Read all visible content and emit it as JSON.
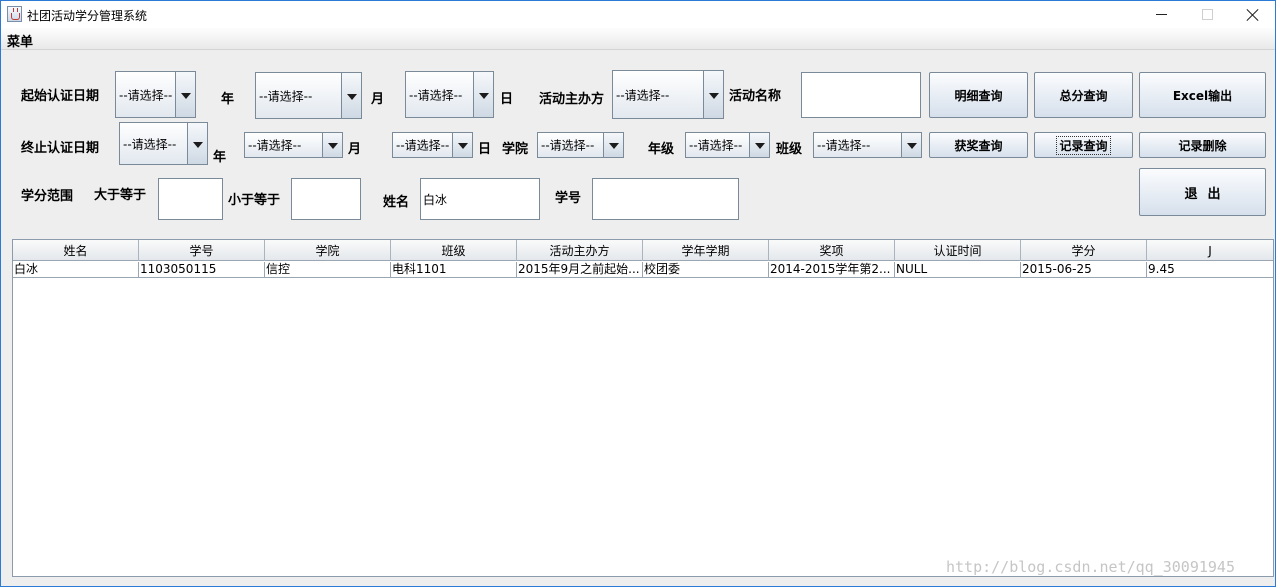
{
  "window": {
    "title": "社团活动学分管理系统"
  },
  "menubar": {
    "menu_label": "菜单"
  },
  "form": {
    "start_date_label": "起始认证日期",
    "end_date_label": "终止认证日期",
    "year_unit": "年",
    "month_unit": "月",
    "day_unit": "日",
    "organizer_label": "活动主办方",
    "activity_name_label": "活动名称",
    "college_label": "学院",
    "grade_label": "年级",
    "class_label": "班级",
    "credit_range_label": "学分范围",
    "gte_label": "大于等于",
    "lte_label": "小于等于",
    "name_label": "姓名",
    "student_id_label": "学号",
    "placeholder_option": "--请选择--",
    "activity_name_value": "",
    "credit_min_value": "",
    "credit_max_value": "",
    "name_value": "白冰",
    "student_id_value": ""
  },
  "buttons": {
    "detail_query": "明细查询",
    "total_query": "总分查询",
    "excel_export": "Excel输出",
    "award_query": "获奖查询",
    "record_query": "记录查询",
    "record_delete": "记录删除",
    "exit": "退出"
  },
  "table": {
    "columns": [
      "姓名",
      "学号",
      "学院",
      "班级",
      "活动主办方",
      "学年学期",
      "奖项",
      "认证时间",
      "学分",
      "J"
    ],
    "rows": [
      [
        "白冰",
        "1103050115",
        "信控",
        "电科1101",
        "2015年9月之前起始...",
        "校团委",
        "2014-2015学年第2...",
        "NULL",
        "2015-06-25",
        "9.45"
      ]
    ]
  },
  "watermark": "http://blog.csdn.net/qq_30091945"
}
